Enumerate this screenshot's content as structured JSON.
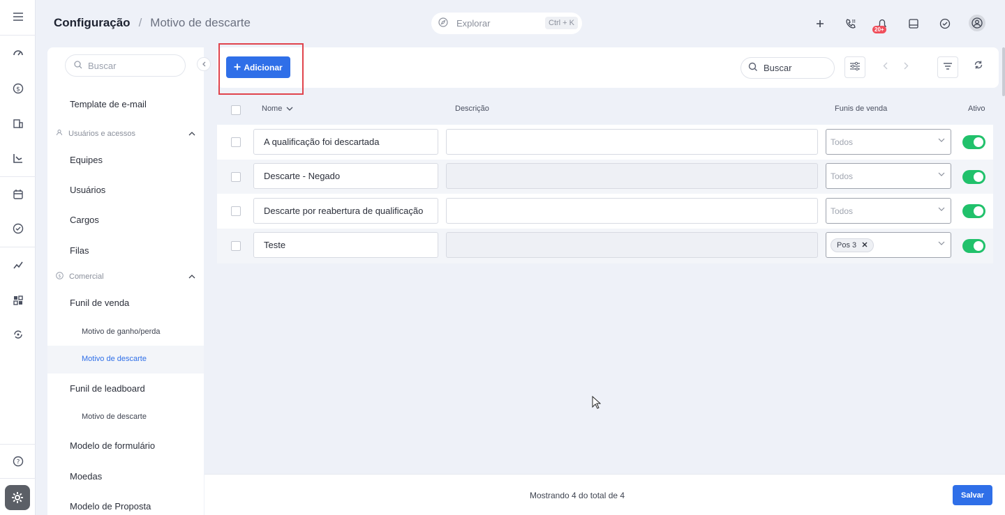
{
  "header": {
    "breadcrumb_root": "Configuração",
    "breadcrumb_sep": "/",
    "breadcrumb_current": "Motivo de descarte",
    "explore_placeholder": "Explorar",
    "explore_shortcut": "Ctrl + K",
    "notification_badge": "20+"
  },
  "sidebar": {
    "search_placeholder": "Buscar",
    "items": {
      "template_email": "Template de e-mail",
      "group_users": "Usuários e acessos",
      "equipes": "Equipes",
      "usuarios": "Usuários",
      "cargos": "Cargos",
      "filas": "Filas",
      "group_comercial": "Comercial",
      "funil_venda": "Funil de venda",
      "motivo_ganho": "Motivo de ganho/perda",
      "motivo_descarte": "Motivo de descarte",
      "funil_leadboard": "Funil de leadboard",
      "motivo_descarte_2": "Motivo de descarte",
      "modelo_formulario": "Modelo de formulário",
      "moedas": "Moedas",
      "modelo_proposta": "Modelo de Proposta"
    }
  },
  "toolbar": {
    "add_label": "Adicionar",
    "search_placeholder": "Buscar"
  },
  "table": {
    "columns": {
      "nome": "Nome",
      "descricao": "Descrição",
      "funis": "Funis de venda",
      "ativo": "Ativo"
    },
    "rows": [
      {
        "nome": "A qualificação foi descartada",
        "descricao": "",
        "funis": "Todos",
        "tag": "",
        "ativo": true
      },
      {
        "nome": "Descarte - Negado",
        "descricao": "",
        "funis": "Todos",
        "tag": "",
        "ativo": true
      },
      {
        "nome": "Descarte por reabertura de qualificação",
        "descricao": "",
        "funis": "Todos",
        "tag": "",
        "ativo": true
      },
      {
        "nome": "Teste",
        "descricao": "",
        "funis": "",
        "tag": "Pos 3",
        "ativo": true
      }
    ]
  },
  "footer": {
    "count_text": "Mostrando 4 do total de 4",
    "save_label": "Salvar"
  },
  "colors": {
    "accent": "#2f6fe8",
    "toggle_on": "#21c16b",
    "highlight": "#e0434c",
    "badge": "#f04e5b"
  }
}
